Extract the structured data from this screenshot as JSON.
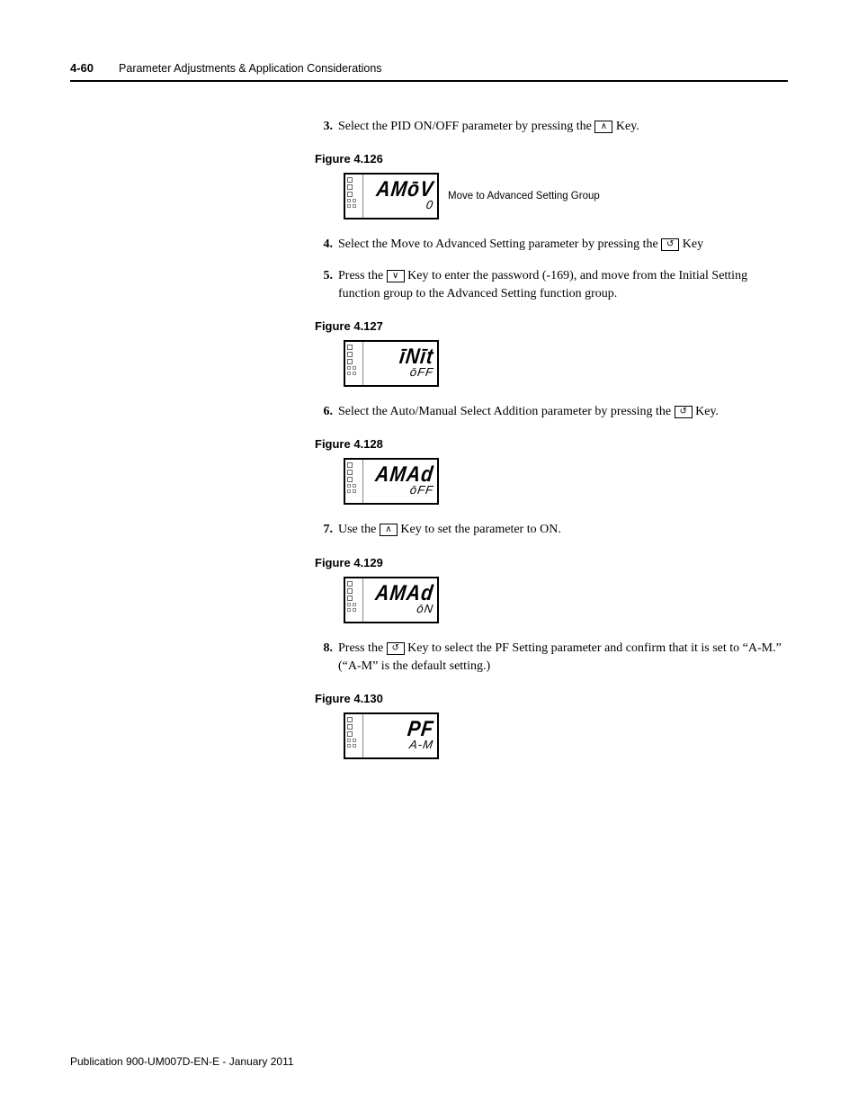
{
  "header": {
    "page_num": "4-60",
    "chapter": "Parameter Adjustments & Application Considerations"
  },
  "steps": {
    "s3": {
      "num": "3.",
      "text_a": "Select the PID ON/OFF parameter by pressing the ",
      "key": "up",
      "text_b": " Key."
    },
    "s4": {
      "num": "4.",
      "text_a": "Select the Move to Advanced Setting parameter by pressing the ",
      "key": "loop",
      "text_b": " Key"
    },
    "s5": {
      "num": "5.",
      "text_a": "Press the ",
      "key": "down",
      "text_b": " Key to enter the password (-169), and move from the Initial Setting function group to the Advanced Setting function group."
    },
    "s6": {
      "num": "6.",
      "text_a": "Select the Auto/Manual Select Addition parameter by pressing the ",
      "key": "loop",
      "text_b": " Key."
    },
    "s7": {
      "num": "7.",
      "text_a": "Use the ",
      "key": "up",
      "text_b": " Key to set the parameter to ON."
    },
    "s8": {
      "num": "8.",
      "text_a": "Press the ",
      "key": "loop",
      "text_b": " Key to select the PF Setting parameter and confirm that it is set to “A-M.” (“A-M” is the default setting.)"
    }
  },
  "figures": {
    "f126": {
      "label": "Figure 4.126",
      "line1": "AMōV",
      "line2": "0",
      "caption": "Move to Advanced Setting Group"
    },
    "f127": {
      "label": "Figure 4.127",
      "line1": "īNīt",
      "line2": "ōFF"
    },
    "f128": {
      "label": "Figure 4.128",
      "line1": "AMAd",
      "line2": "ōFF"
    },
    "f129": {
      "label": "Figure 4.129",
      "line1": "AMAd",
      "line2": "ōN"
    },
    "f130": {
      "label": "Figure 4.130",
      "line1": "PF",
      "line2": "A-M"
    }
  },
  "key_glyphs": {
    "up": "∧",
    "down": "∨",
    "loop": "↺"
  },
  "footer": "Publication 900-UM007D-EN-E - January 2011"
}
